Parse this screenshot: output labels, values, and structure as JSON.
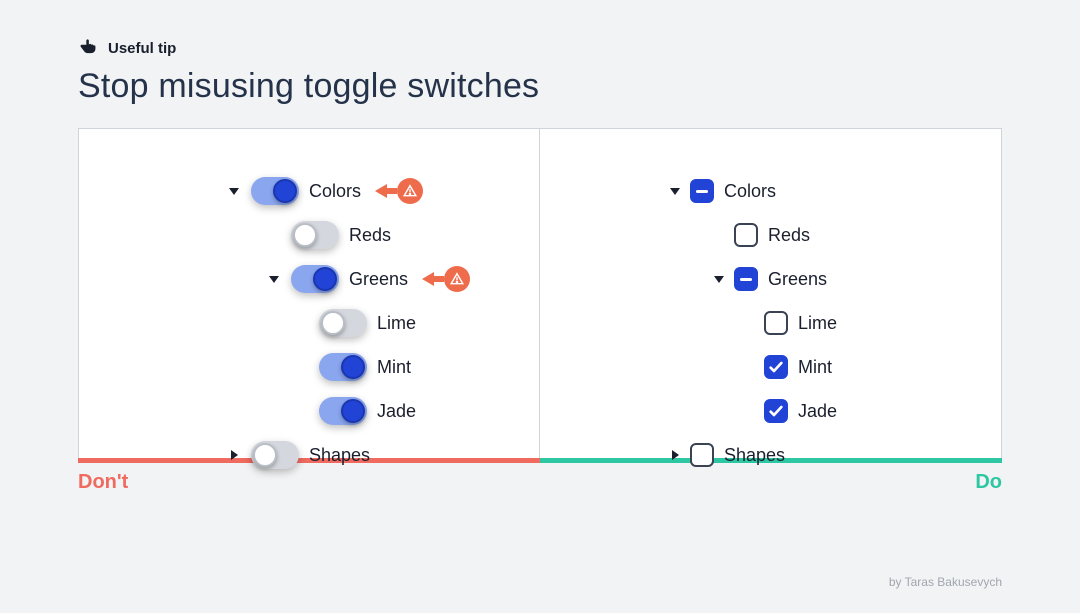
{
  "tip_label": "Useful tip",
  "headline": "Stop misusing toggle switches",
  "labels": {
    "dont": "Don't",
    "do": "Do"
  },
  "credit": "by Taras Bakusevych",
  "colors": {
    "accent_blue": "#2143d6",
    "error_red": "#ef6a5f",
    "success_green": "#2dc8a3",
    "warn_orange": "#ee6b4b"
  },
  "left_tree": {
    "colors": {
      "label": "Colors",
      "toggle": "on",
      "expanded": true,
      "warn": true
    },
    "reds": {
      "label": "Reds",
      "toggle": "off"
    },
    "greens": {
      "label": "Greens",
      "toggle": "on",
      "expanded": true,
      "warn": true
    },
    "lime": {
      "label": "Lime",
      "toggle": "off"
    },
    "mint": {
      "label": "Mint",
      "toggle": "on"
    },
    "jade": {
      "label": "Jade",
      "toggle": "on"
    },
    "shapes": {
      "label": "Shapes",
      "toggle": "off",
      "expanded": false
    }
  },
  "right_tree": {
    "colors": {
      "label": "Colors",
      "state": "indeterminate",
      "expanded": true
    },
    "reds": {
      "label": "Reds",
      "state": "unchecked"
    },
    "greens": {
      "label": "Greens",
      "state": "indeterminate",
      "expanded": true
    },
    "lime": {
      "label": "Lime",
      "state": "unchecked"
    },
    "mint": {
      "label": "Mint",
      "state": "checked"
    },
    "jade": {
      "label": "Jade",
      "state": "checked"
    },
    "shapes": {
      "label": "Shapes",
      "state": "unchecked",
      "expanded": false
    }
  }
}
